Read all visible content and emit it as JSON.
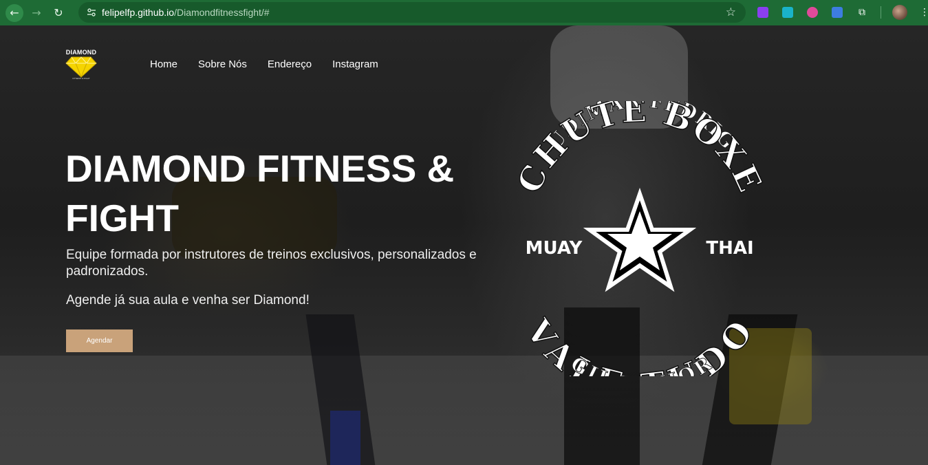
{
  "browser": {
    "url_host": "felipelfp.github.io",
    "url_path": "/Diamondfitnessfight/#"
  },
  "logo": {
    "word": "DIAMOND",
    "sub": "FITNESS & FIGHT",
    "color": "#f5d400"
  },
  "nav": {
    "items": [
      {
        "label": "Home"
      },
      {
        "label": "Sobre Nós"
      },
      {
        "label": "Endereço"
      },
      {
        "label": "Instagram"
      }
    ]
  },
  "hero": {
    "title": "DIAMOND FITNESS & FIGHT",
    "description": "Equipe formada por instrutores de treinos exclusivos, personalizados e padronizados.",
    "cta_text": "Agende já sua aula e venha ser Diamond!",
    "button_label": "Agendar",
    "button_color": "#c9a27a"
  },
  "emblem": {
    "top_arc": "RUDIMAR FEDRIGO",
    "upper_arc": "CHUTE BOXE",
    "left": "MUAY",
    "right": "THAI",
    "lower_arc": "VALE TUDO",
    "bottom_arc": "GIL JUNIOR"
  }
}
